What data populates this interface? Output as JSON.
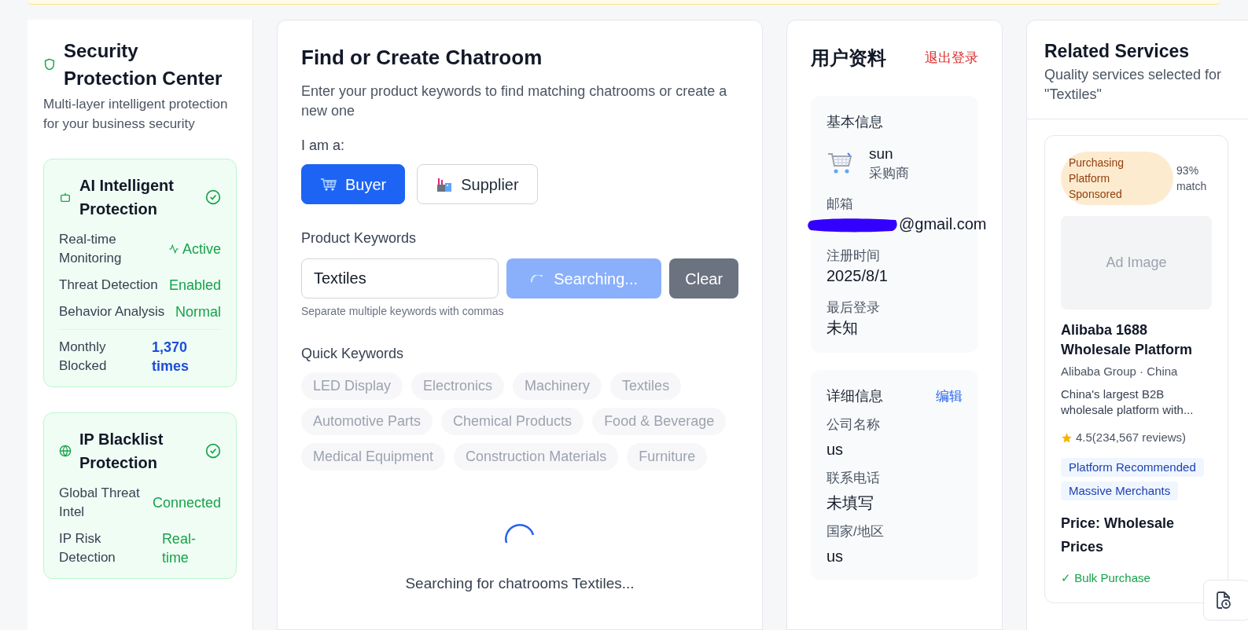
{
  "security": {
    "title": "Security Protection Center",
    "subtitle": "Multi-layer intelligent protection for your business security",
    "sections": [
      {
        "kind": "ai",
        "title": "AI Intelligent Protection",
        "verified": true,
        "rows": [
          {
            "kind": "pulse",
            "label": "Real-time Monitoring",
            "value": "Active"
          },
          {
            "kind": "plain",
            "label": "Threat Detection",
            "value": "Enabled"
          },
          {
            "kind": "plain",
            "label": "Behavior Analysis",
            "value": "Normal"
          },
          {
            "kind": "metric",
            "label": "Monthly Blocked",
            "value": "1,370 times"
          }
        ]
      },
      {
        "kind": "ip",
        "title": "IP Blacklist Protection",
        "verified": true,
        "rows": [
          {
            "kind": "plain",
            "label": "Global Threat Intel",
            "value": "Connected"
          },
          {
            "kind": "plain",
            "label": "IP Risk Detection",
            "value": "Real-time"
          }
        ]
      }
    ]
  },
  "chatroom": {
    "title": "Find or Create Chatroom",
    "description": "Enter your product keywords to find matching chatrooms or create a new one",
    "role_label": "I am a:",
    "roles": [
      {
        "kind": "buyer",
        "label": "Buyer",
        "selected": true
      },
      {
        "kind": "supplier",
        "label": "Supplier",
        "selected": false
      }
    ],
    "keywords_label": "Product Keywords",
    "keyword_input": {
      "value": "Textiles"
    },
    "search_button": {
      "label": "Searching...",
      "loading": true
    },
    "clear_button": {
      "label": "Clear"
    },
    "hint": "Separate multiple keywords with commas",
    "quick_label": "Quick Keywords",
    "quick_disabled": true,
    "quick_keywords": [
      "LED Display",
      "Electronics",
      "Machinery",
      "Textiles",
      "Automotive Parts",
      "Chemical Products",
      "Food & Beverage",
      "Medical Equipment",
      "Construction Materials",
      "Furniture"
    ],
    "loading": true,
    "status_text": "Searching for chatrooms Textiles..."
  },
  "profile": {
    "title": "用户资料",
    "logout": "退出登录",
    "basic": {
      "title": "基本信息",
      "name": "sun",
      "role": "采购商",
      "fields": [
        {
          "label": "邮箱",
          "value": "@gmail.com",
          "redacted": true
        },
        {
          "label": "注册时间",
          "value": "2025/8/1"
        },
        {
          "label": "最后登录",
          "value": "未知"
        }
      ]
    },
    "details": {
      "title": "详细信息",
      "edit": "编辑",
      "fields": [
        {
          "label": "公司名称",
          "value": "us"
        },
        {
          "label": "联系电话",
          "value": "未填写"
        },
        {
          "label": "国家/地区",
          "value": "us"
        }
      ]
    }
  },
  "related": {
    "title": "Related Services",
    "subtitle": "Quality services selected for \"Textiles\"",
    "card": {
      "badge": "Purchasing Platform Sponsored",
      "match": "93% match",
      "image_label": "Ad Image",
      "name": "Alibaba 1688 Wholesale Platform",
      "meta": "Alibaba Group · China",
      "description": "China's largest B2B wholesale platform with...",
      "rating": "4.5(234,567 reviews)",
      "tags": [
        "Platform Recommended",
        "Massive Merchants"
      ],
      "price": "Price: Wholesale Prices",
      "features": [
        "✓ Bulk Purchase"
      ]
    }
  }
}
